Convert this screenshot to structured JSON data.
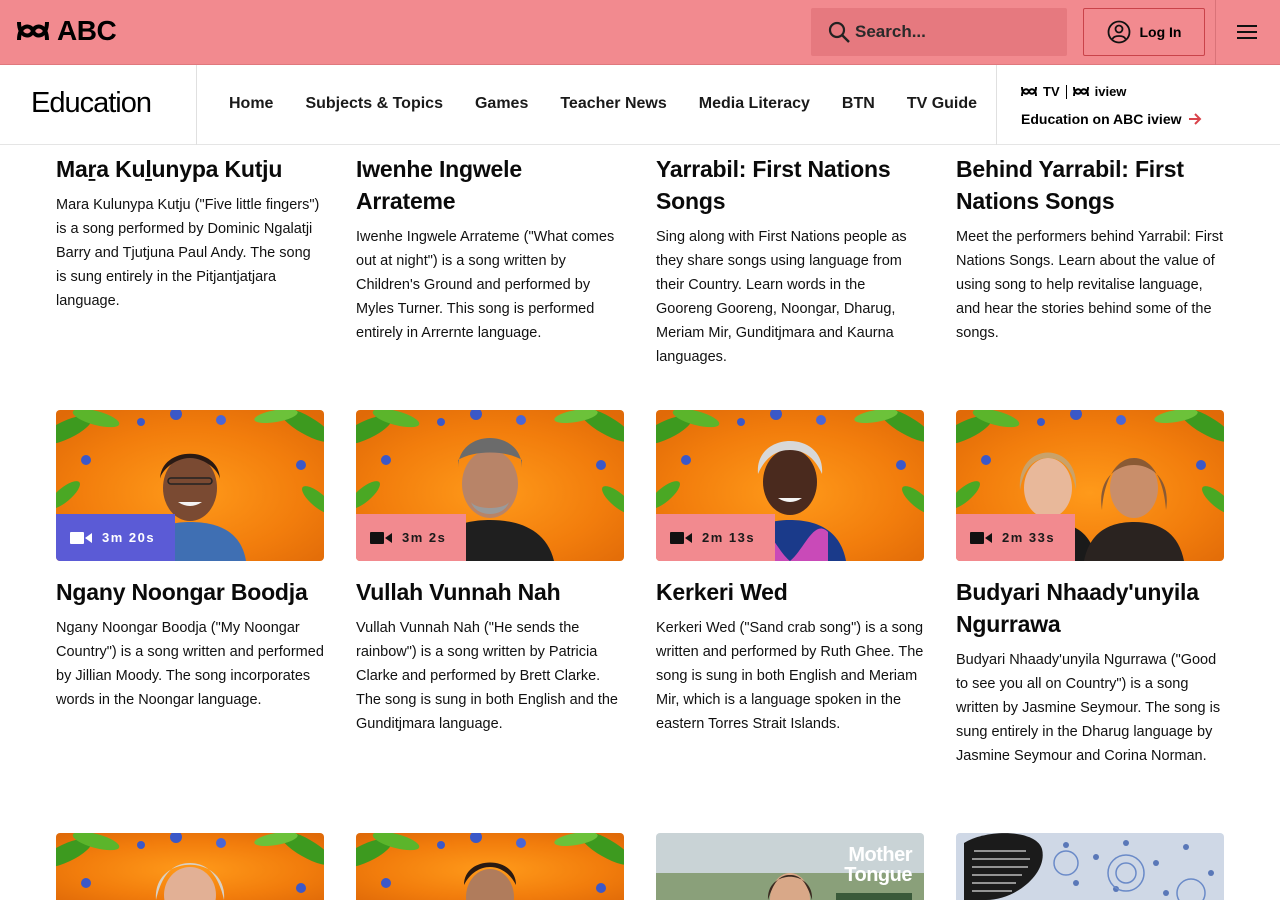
{
  "header": {
    "logo_text": "ABC",
    "search_placeholder": "Search...",
    "login_label": "Log In",
    "menu_icon": "hamburger-menu-icon"
  },
  "subnav": {
    "brand": "Education",
    "links": [
      "Home",
      "Subjects & Topics",
      "Games",
      "Teacher News",
      "Media Literacy",
      "BTN",
      "TV Guide"
    ],
    "promo_logo_tv": "TV",
    "promo_logo_iview": "iview",
    "promo_link": "Education on ABC iview"
  },
  "colors": {
    "header_bg": "#f28a8f",
    "badge_blue": "#5b5bd6",
    "badge_pink": "#f28a8f"
  },
  "row1": [
    {
      "title": "Maṟa Kuḻunypa Kutju",
      "desc": "Mara Kulunypa Kutju (\"Five little fingers\") is a song performed by Dominic Ngalatji Barry and Tjutjuna Paul Andy. The song is sung entirely in the Pitjantjatjara language."
    },
    {
      "title": "Iwenhe Ingwele Arrateme",
      "desc": "Iwenhe Ingwele Arrateme (\"What comes out at night\") is a song written by Children's Ground and performed by Myles Turner. This song is performed entirely in Arrernte language."
    },
    {
      "title": "Yarrabil: First Nations Songs",
      "desc": "Sing along with First Nations people as they share songs using language from their Country. Learn words in the Gooreng Gooreng, Noongar, Dharug, Meriam Mir, Gunditjmara and Kaurna languages."
    },
    {
      "title": "Behind Yarrabil: First Nations Songs",
      "desc": "Meet the performers behind Yarrabil: First Nations Songs. Learn about the value of using song to help revitalise language, and hear the stories behind some of the songs."
    }
  ],
  "row2": [
    {
      "duration": "3m 20s",
      "title": "Ngany Noongar Boodja",
      "desc": "Ngany Noongar Boodja (\"My Noongar Country\") is a song written and performed by Jillian Moody. The song incorporates words in the Noongar language."
    },
    {
      "duration": "3m 2s",
      "title": "Vullah Vunnah Nah",
      "desc": "Vullah Vunnah Nah (\"He sends the rainbow\") is a song written by Patricia Clarke and performed by Brett Clarke. The song is sung in both English and the Gunditjmara language."
    },
    {
      "duration": "2m 13s",
      "title": "Kerkeri Wed",
      "desc": "Kerkeri Wed (\"Sand crab song\") is a song written and performed by Ruth Ghee. The song is sung in both English and Meriam Mir, which is a language spoken in the eastern Torres Strait Islands."
    },
    {
      "duration": "2m 33s",
      "title": "Budyari Nhaady'unyila Ngurrawa",
      "desc": "Budyari Nhaady'unyila Ngurrawa (\"Good to see you all on Country\") is a song written by Jasmine Seymour. The song is sung entirely in the Dharug language by Jasmine Seymour and Corina Norman."
    }
  ],
  "row3": {
    "thumb3_overlay": "Mother Tongue"
  }
}
